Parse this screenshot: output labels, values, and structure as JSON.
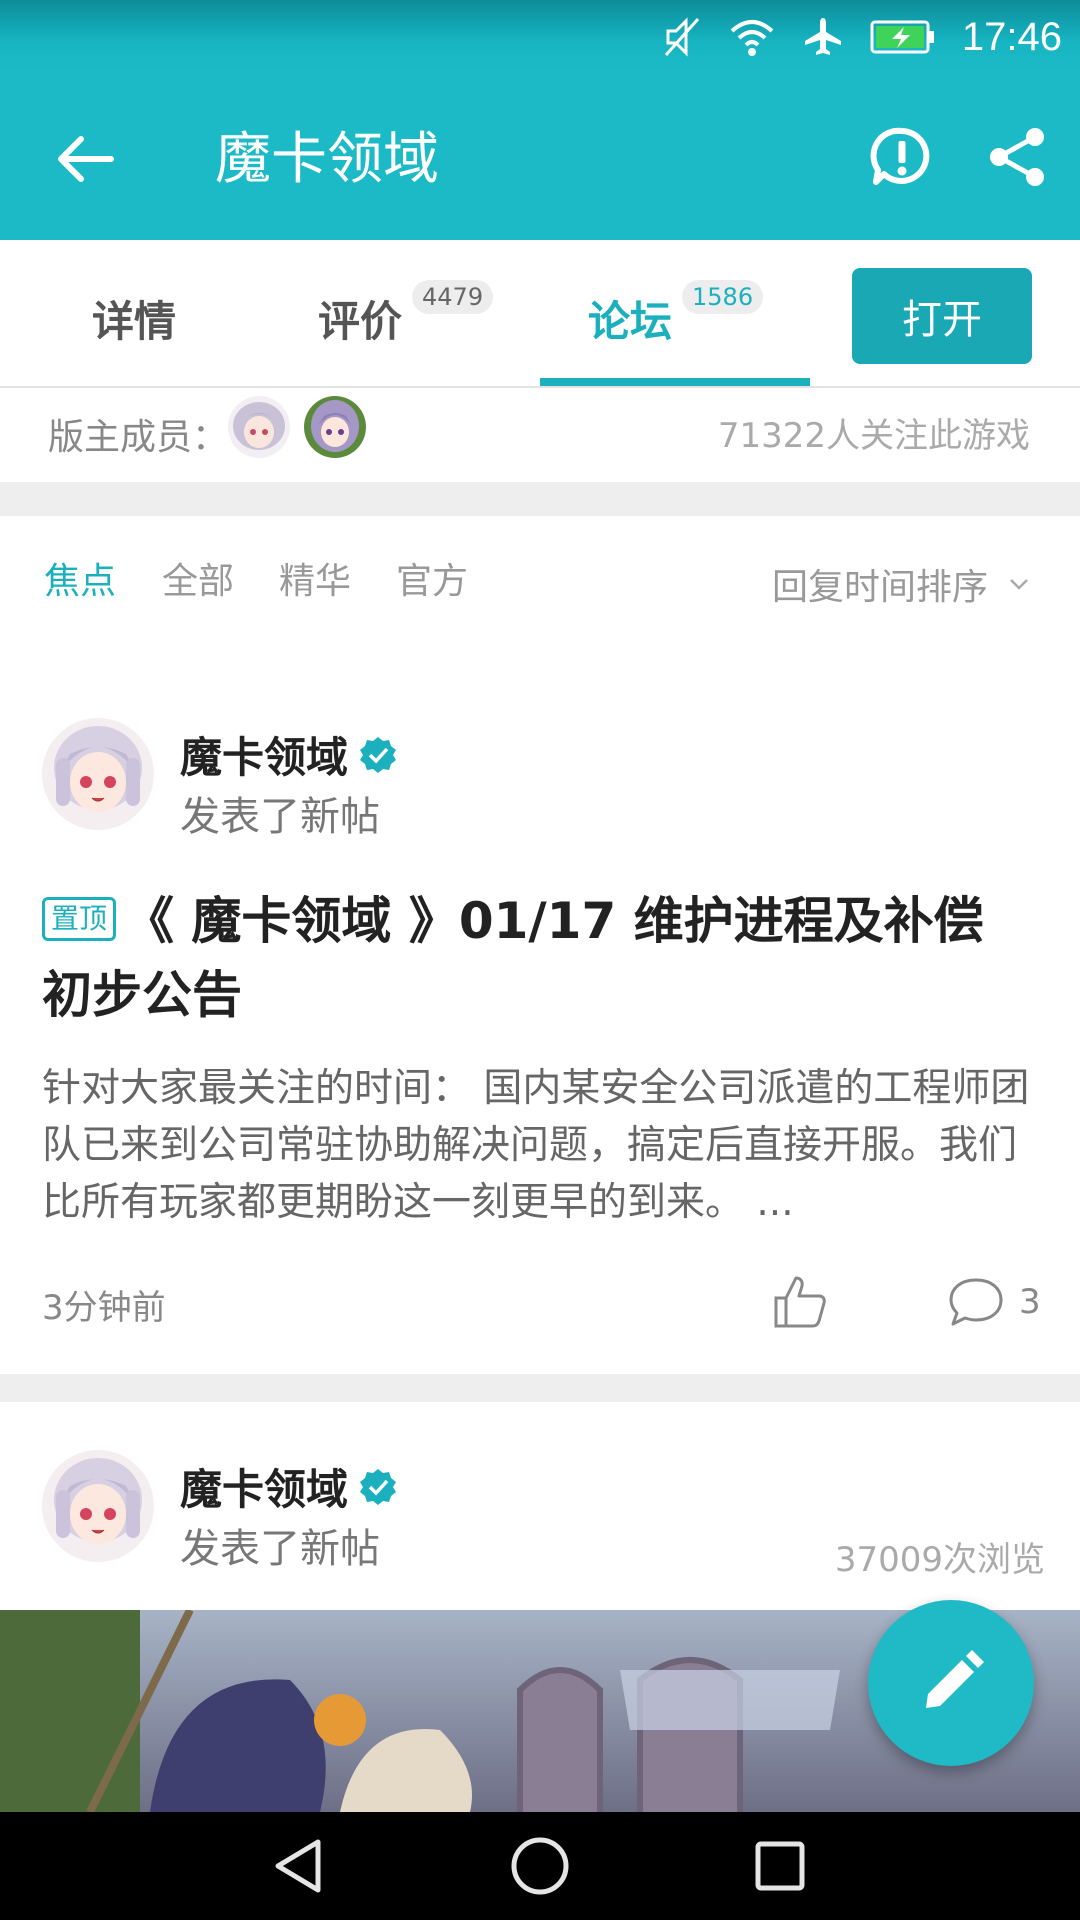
{
  "status_bar": {
    "time": "17:46",
    "icons": [
      "mute-icon",
      "wifi-icon",
      "airplane-icon",
      "battery-charging-icon"
    ]
  },
  "header": {
    "title": "魔卡领域",
    "back_icon": "arrow-left-icon",
    "report_icon": "exclamation-circle-icon",
    "share_icon": "share-icon"
  },
  "tabs": [
    {
      "label": "详情",
      "count": ""
    },
    {
      "label": "评价",
      "count": "4479"
    },
    {
      "label": "论坛",
      "count": "1586",
      "active": true
    }
  ],
  "open_button": "打开",
  "moderators": {
    "label": "版主成员：",
    "followers": "71322人关注此游戏"
  },
  "filters": {
    "items": [
      "焦点",
      "全部",
      "精华",
      "官方"
    ],
    "active": "焦点",
    "sort": "回复时间排序"
  },
  "posts": [
    {
      "author": "魔卡领域",
      "action": "发表了新帖",
      "pinned_label": "置顶",
      "title": "《 魔卡领域 》01/17  维护进程及补偿初步公告",
      "excerpt": "针对大家最关注的时间： 国内某安全公司派遣的工程师团队已来到公司常驻协助解决问题，搞定后直接开服。我们比所有玩家都更期盼这一刻更早的到来。 ...",
      "time": "3分钟前",
      "comments": "3"
    },
    {
      "author": "魔卡领域",
      "action": "发表了新帖",
      "views": "37009次浏览"
    }
  ],
  "colors": {
    "accent": "#1cb0be",
    "header": "#1cbac6",
    "open_button": "#1aa8b5"
  }
}
